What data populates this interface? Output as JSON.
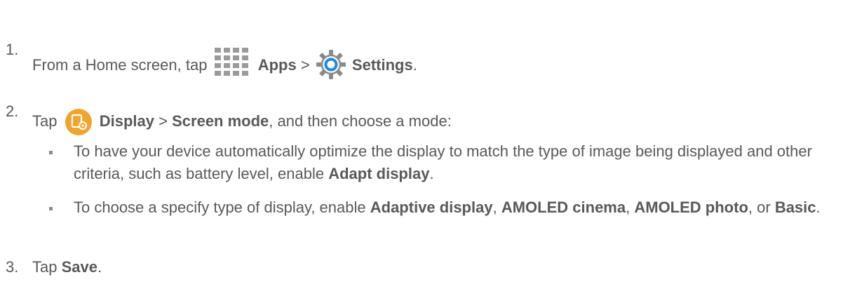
{
  "steps": [
    {
      "number": "1.",
      "text_a": "From a Home screen, tap",
      "apps_label": "Apps",
      "sep": ">",
      "settings_label": "Settings",
      "end": "."
    },
    {
      "number": "2.",
      "text_a": "Tap",
      "display_label": "Display",
      "sep": ">",
      "screen_mode_label": "Screen mode",
      "text_b": ", and then choose a mode:"
    },
    {
      "number": "3.",
      "text_a": "Tap",
      "save_label": "Save",
      "end": "."
    }
  ],
  "bullets": [
    {
      "text_a": "To have your device automatically optimize the display to match the type of image being displayed and other criteria, such as battery level, enable",
      "bold_a": "Adapt display",
      "end": "."
    },
    {
      "text_a": "To choose a specify type of display, enable",
      "bold_a": "Adaptive display",
      "sep_a": ",",
      "bold_b": "AMOLED cinema",
      "sep_b": ",",
      "bold_c": "AMOLED photo",
      "sep_c": ", or",
      "bold_d": "Basic",
      "end": "."
    }
  ],
  "icons": {
    "apps": "apps-grid-icon",
    "settings": "settings-gear-icon",
    "display": "display-icon"
  },
  "colors": {
    "text": "#595959",
    "apps_grid": "#9a9a9a",
    "settings_blue": "#1e88e5",
    "display_orange": "#f1a52c"
  }
}
